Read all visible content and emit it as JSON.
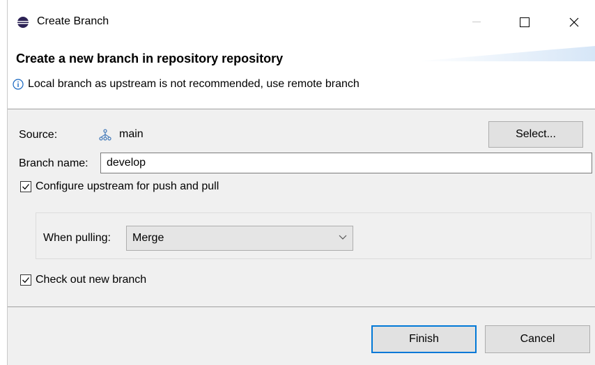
{
  "window": {
    "title": "Create Branch",
    "title_icon": "eclipse-logo-icon"
  },
  "header": {
    "title": "Create a new branch in repository repository",
    "info_icon": "info-icon",
    "info_message": "Local branch as upstream is not recommended, use remote branch"
  },
  "form": {
    "source_label": "Source:",
    "source_icon": "branch-icon",
    "source_value": "main",
    "select_button": "Select...",
    "branch_name_label": "Branch name:",
    "branch_name_value": "develop",
    "configure_upstream_label": "Configure upstream for push and pull",
    "configure_upstream_checked": true,
    "when_pulling_label": "When pulling:",
    "when_pulling_value": "Merge",
    "checkout_label": "Check out new branch",
    "checkout_checked": true
  },
  "footer": {
    "finish_label": "Finish",
    "cancel_label": "Cancel"
  },
  "colors": {
    "dialog_background": "#f0f0f0",
    "header_background": "#ffffff",
    "default_button_border": "#0078d7",
    "button_face": "#e1e1e1",
    "info_icon": "#1565c0"
  }
}
